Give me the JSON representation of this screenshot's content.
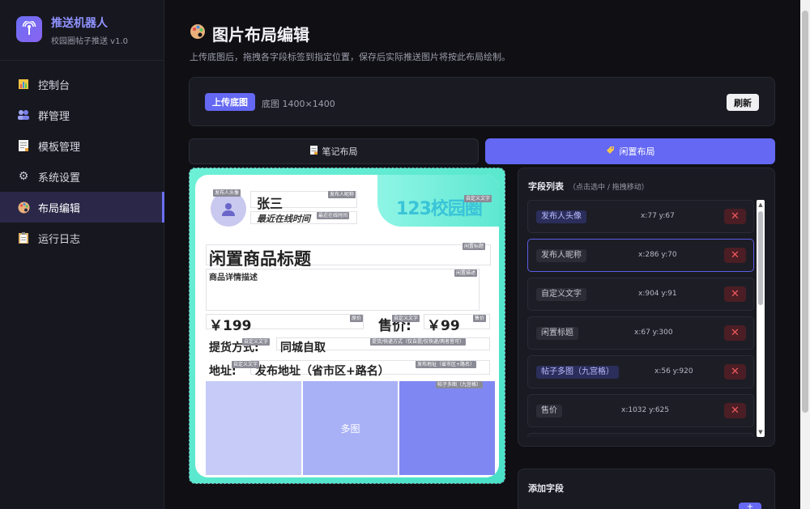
{
  "brand": {
    "title": "推送机器人",
    "subtitle": "校园圈帖子推送 v1.0"
  },
  "nav": [
    {
      "label": "控制台",
      "icon": "chart-icon"
    },
    {
      "label": "群管理",
      "icon": "group-icon"
    },
    {
      "label": "模板管理",
      "icon": "document-icon"
    },
    {
      "label": "系统设置",
      "icon": "gear-icon"
    },
    {
      "label": "布局编辑",
      "icon": "palette-icon",
      "active": true
    },
    {
      "label": "运行日志",
      "icon": "clipboard-icon"
    }
  ],
  "page": {
    "title": "图片布局编辑",
    "description": "上传底图后，拖拽各字段标签到指定位置，保存后实际推送图片将按此布局绘制。"
  },
  "upload": {
    "button": "上传底图",
    "size": "底图 1400×1400",
    "refresh": "刷新"
  },
  "tabs": {
    "note": "笔记布局",
    "idle": "闲置布局"
  },
  "canvas": {
    "badge": "123校园圈",
    "name": "张三",
    "online": "最近在线时间",
    "title": "闲置商品标题",
    "desc": "商品详情描述",
    "price": "￥199",
    "sale_label": "售价:",
    "sale_value": "￥99",
    "delivery": "提货方式:",
    "delivery_value": "同城自取",
    "address": "地址:",
    "address_value": "发布地址（省市区+路名）",
    "grid_label": "多图",
    "tags": {
      "avatar": "发布人头像",
      "nickname": "发布人昵称",
      "custom1": "自定义文字",
      "online": "最近在线时间",
      "title": "闲置标题",
      "desc": "闲置描述",
      "price": "原价",
      "custom2": "自定义文字",
      "sale": "售价",
      "custom3": "自定义文字",
      "delivery": "提货/快递方式（仅自提/仅快递/两者皆可）",
      "custom4": "自定义文字",
      "address": "发布地址（省市区+路名）",
      "images": "帖子多图（九宫格）"
    }
  },
  "fields": {
    "title": "字段列表",
    "hint": "（点击选中 / 拖拽移动）",
    "items": [
      {
        "label": "发布人头像",
        "coord": "x:77 y:67",
        "style": "blue"
      },
      {
        "label": "发布人昵称",
        "coord": "x:286 y:70",
        "style": "gray",
        "selected": true
      },
      {
        "label": "自定义文字",
        "coord": "x:904 y:91",
        "style": "gray"
      },
      {
        "label": "闲置标题",
        "coord": "x:67 y:300",
        "style": "gray"
      },
      {
        "label": "帖子多图（九宫格）",
        "coord": "x:56 y:920",
        "style": "blue"
      },
      {
        "label": "售价",
        "coord": "x:1032 y:625",
        "style": "gray"
      }
    ],
    "delete_glyph": "✕"
  },
  "add": {
    "title": "添加字段",
    "button": "+"
  }
}
